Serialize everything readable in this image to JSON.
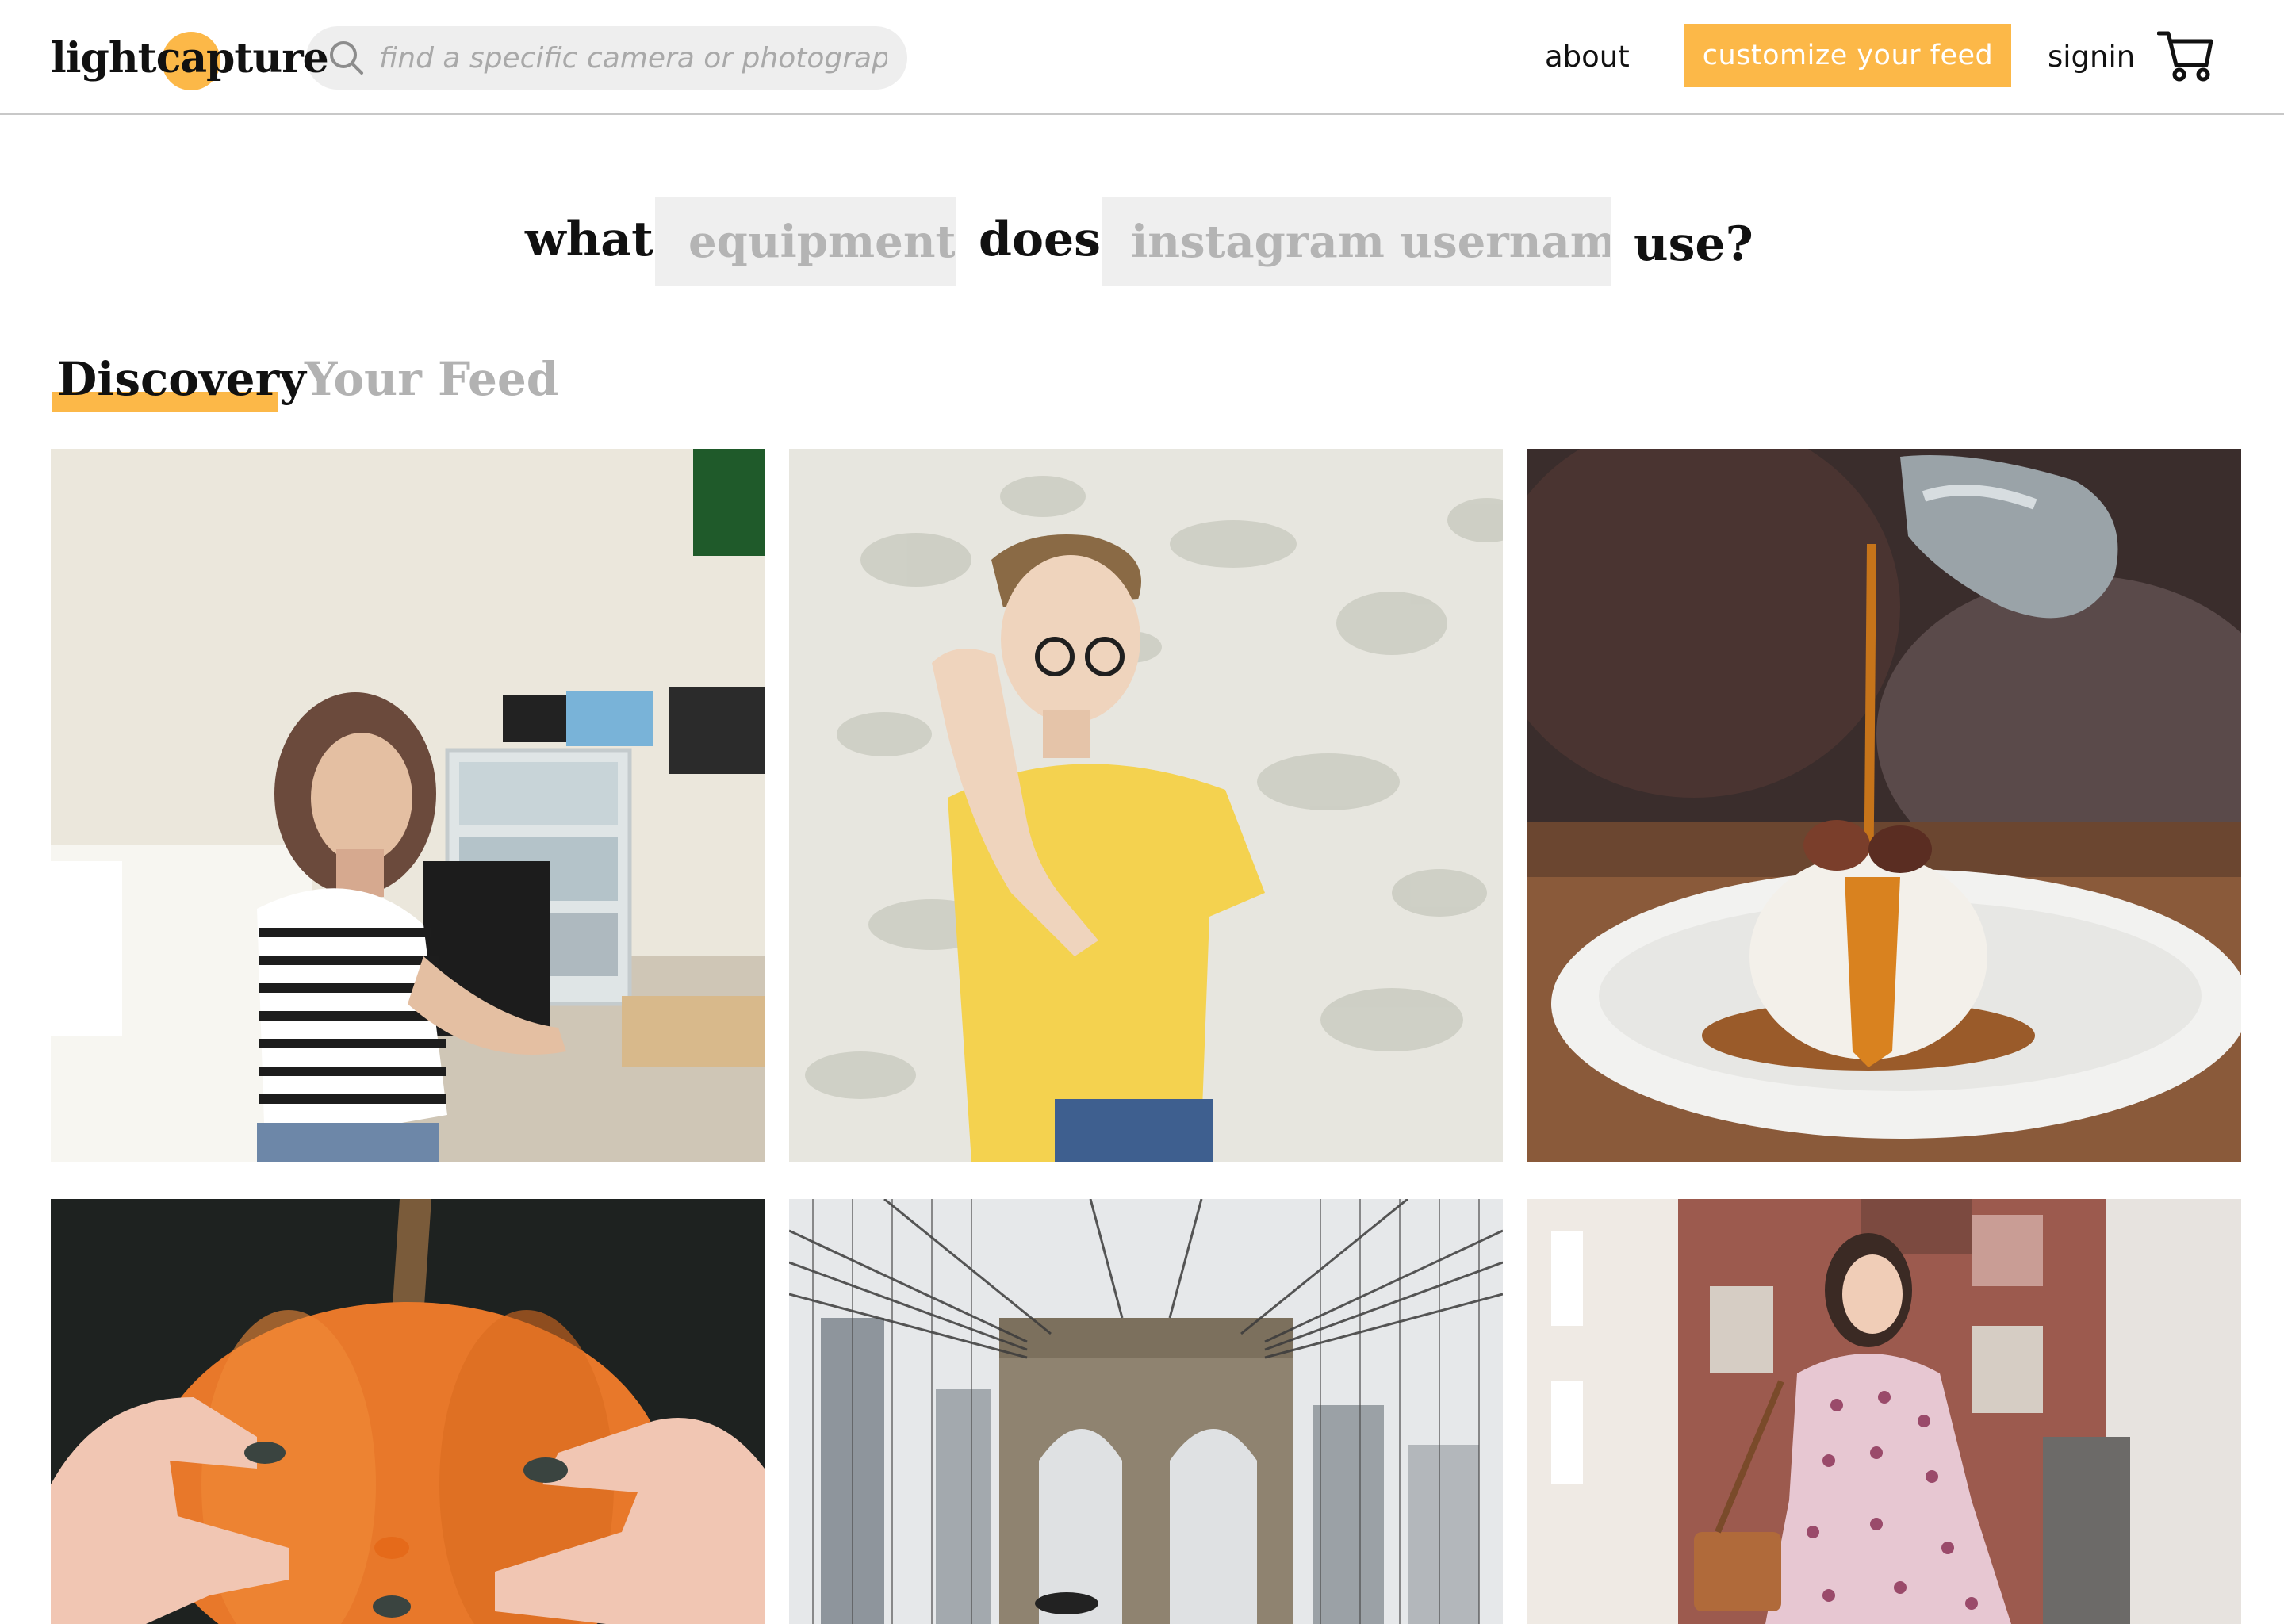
{
  "brand": {
    "name": "lightcapture"
  },
  "header": {
    "search_placeholder": "find a specific camera or photographer",
    "about": "about",
    "customize": "customize your feed",
    "signin": "signin"
  },
  "question": {
    "word_what": "what",
    "equipment_placeholder": "equipment",
    "word_does": "does",
    "username_placeholder": "instagram username",
    "word_use": "use?"
  },
  "tabs": [
    {
      "label": "Discovery",
      "active": true
    },
    {
      "label": "Your Feed",
      "active": false
    }
  ],
  "colors": {
    "accent": "#fcb848",
    "text": "#111111",
    "muted": "#a9a9a9"
  },
  "icons": {
    "search": "search-icon",
    "cart": "cart-icon"
  },
  "photos": [
    "woman-in-striped-shirt-photo",
    "man-in-yellow-shirt-photo",
    "ice-cream-caramel-dessert-photo",
    "hands-holding-pumpkin-photo",
    "brooklyn-bridge-photo",
    "woman-with-bag-on-street-photo"
  ]
}
